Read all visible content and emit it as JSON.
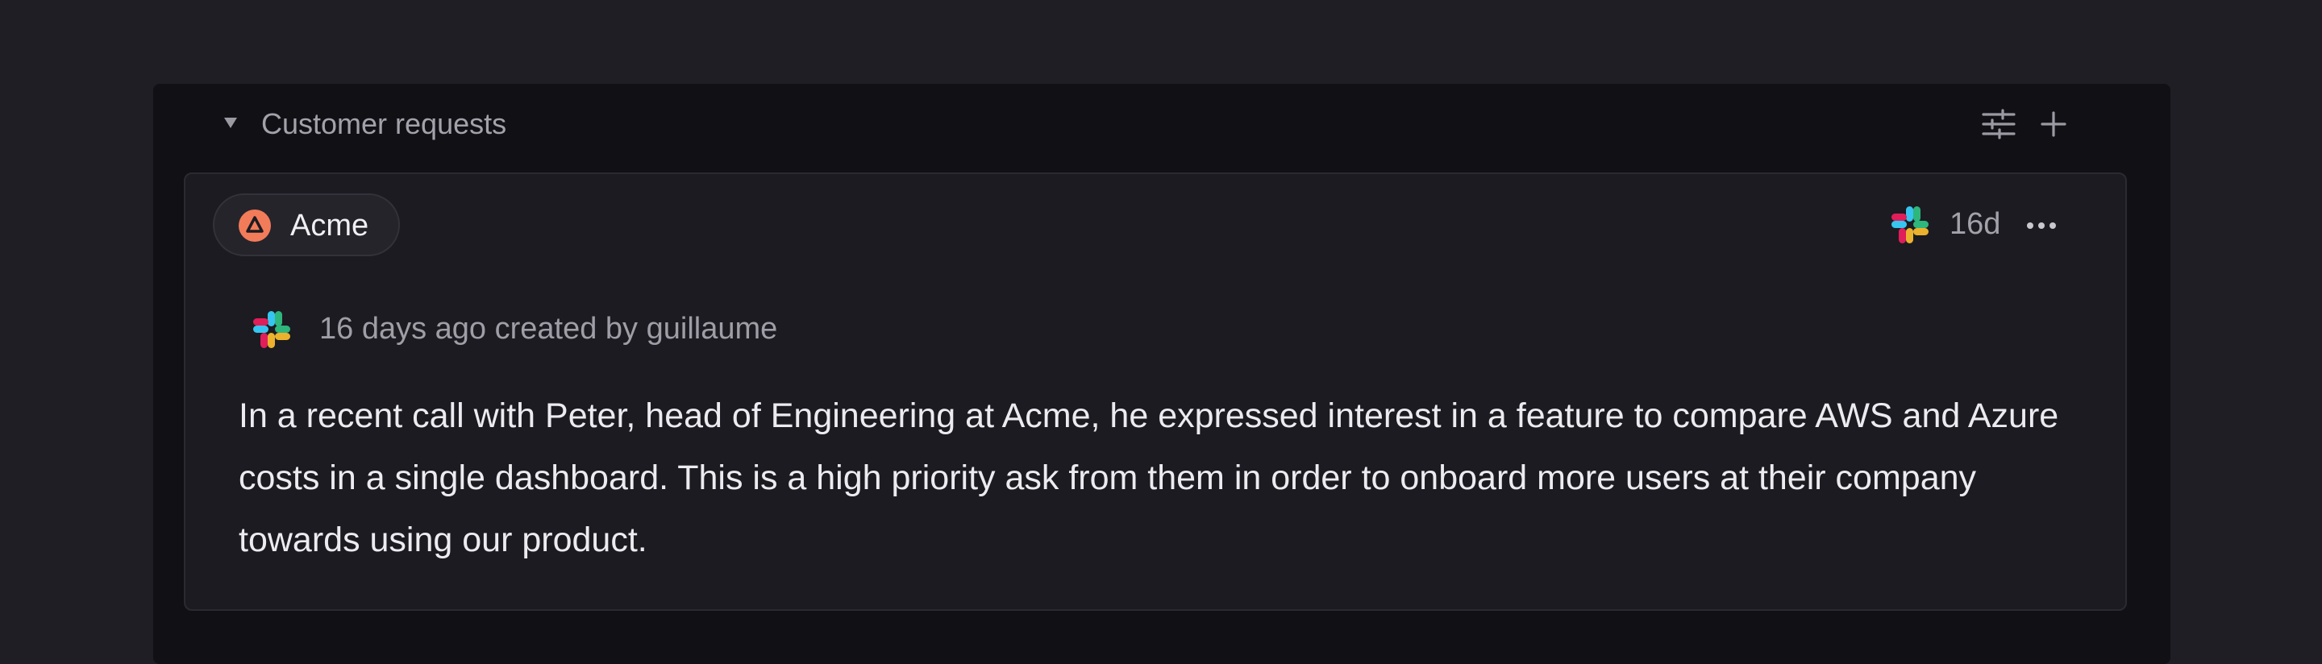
{
  "section": {
    "title": "Customer requests",
    "caret_icon": "caret-down-icon",
    "actions": [
      {
        "icon": "sliders-icon",
        "name": "filter-settings-button"
      },
      {
        "icon": "plus-icon",
        "name": "add-request-button"
      }
    ]
  },
  "request": {
    "customer": {
      "name": "Acme",
      "logo_icon": "acme-logo-icon",
      "logo_color": "#f27c5a"
    },
    "source_icon": "slack-icon",
    "age": "16d",
    "more_icon": "more-horizontal-icon",
    "meta": "16 days ago created by guillaume",
    "body": "In a recent call with Peter, head of Engineering at Acme, he expressed interest in a feature to compare AWS and Azure costs in a single dashboard. This is a high priority ask from them in order to onboard more users at their company towards using our product."
  },
  "colors": {
    "background": "#1f1e24",
    "panel": "#111015",
    "card": "#1c1b21",
    "text_primary": "#ececf0",
    "text_muted": "#a3a2ab",
    "slack_blue": "#36c5f0",
    "slack_green": "#2eb67d",
    "slack_yellow": "#ecb22e",
    "slack_red": "#e01e5a"
  }
}
